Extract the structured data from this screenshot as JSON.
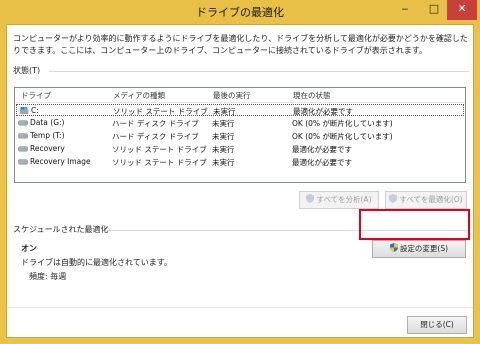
{
  "window": {
    "title": "ドライブの最適化"
  },
  "description": "コンピューターがより効率的に動作するようにドライブを最適化したり、ドライブを分析して最適化が必要かどうかを確認したりできます。ここには、コンピューター上のドライブ、コンピューターに接続されているドライブが表示されます。",
  "status_section": {
    "label": "状態(T)"
  },
  "drive_list": {
    "columns": [
      "ドライブ",
      "メディアの種類",
      "最後の実行",
      "現在の状態"
    ],
    "rows": [
      {
        "drive": "C:",
        "media": "ソリッド ステート ドライブ",
        "last_run": "未実行",
        "status": "最適化が必要です",
        "icon": "system-drive-icon"
      },
      {
        "drive": "Data (G:)",
        "media": "ハード ディスク ドライブ",
        "last_run": "未実行",
        "status": "OK (0% が断片化しています)",
        "icon": "hard-drive-icon"
      },
      {
        "drive": "Temp (T:)",
        "media": "ハード ディスク ドライブ",
        "last_run": "未実行",
        "status": "OK (0% が断片化しています)",
        "icon": "hard-drive-icon"
      },
      {
        "drive": "Recovery",
        "media": "ソリッド ステート ドライブ",
        "last_run": "未実行",
        "status": "最適化が必要です",
        "icon": "hard-drive-icon"
      },
      {
        "drive": "Recovery Image",
        "media": "ソリッド ステート ドライブ",
        "last_run": "未実行",
        "status": "最適化が必要です",
        "icon": "hard-drive-icon"
      }
    ]
  },
  "buttons": {
    "analyze_all": "すべてを分析(A)",
    "optimize_all": "すべてを最適化(O)",
    "change_settings": "設定の変更(S)",
    "close": "閉じる(C)"
  },
  "schedule": {
    "section_label": "スケジュールされた最適化",
    "state": "オン",
    "detail": "ドライブは自動的に最適化されています。",
    "frequency": "頻度: 毎週"
  },
  "colors": {
    "title_bar": "#e8c048",
    "close_button": "#c7403a",
    "highlight": "#e2001a"
  }
}
